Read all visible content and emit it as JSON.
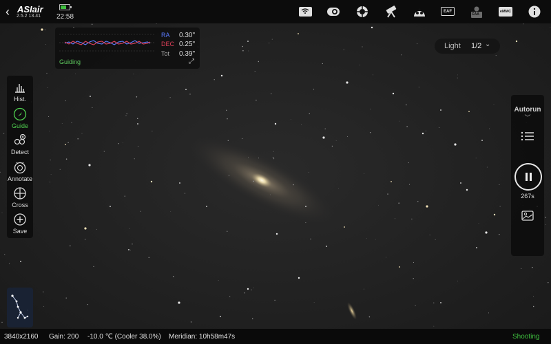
{
  "app": {
    "brand": "ASIair",
    "version": "2.5.2 13.41",
    "clock": "22:58",
    "battery_level": 0.7
  },
  "toolbar_icons": [
    {
      "name": "wifi-icon",
      "label": ""
    },
    {
      "name": "camera-icon",
      "label": ""
    },
    {
      "name": "guide-scope-icon",
      "label": ""
    },
    {
      "name": "telescope-mount-icon",
      "label": ""
    },
    {
      "name": "filter-wheel-icon",
      "label": ""
    },
    {
      "name": "eaf-focuser-icon",
      "label": "EAF"
    },
    {
      "name": "caa-rotator-icon",
      "label": "CAA"
    },
    {
      "name": "emmc-storage-icon",
      "label": "eMMC"
    },
    {
      "name": "info-icon",
      "label": ""
    }
  ],
  "guide": {
    "ra_label": "RA",
    "ra_value": "0.30\"",
    "dec_label": "DEC",
    "dec_value": "0.25\"",
    "tot_label": "Tot",
    "tot_value": "0.39\"",
    "status": "Guiding",
    "ra_color": "#5a7bff",
    "dec_color": "#e0405a"
  },
  "frame_selector": {
    "type": "Light",
    "index": "1/2"
  },
  "left_tools": [
    {
      "label": "Hist.",
      "icon": "histogram-icon"
    },
    {
      "label": "Guide",
      "icon": "guide-icon",
      "active": true
    },
    {
      "label": "Detect",
      "icon": "detect-stars-icon"
    },
    {
      "label": "Annotate",
      "icon": "annotate-icon"
    },
    {
      "label": "Cross",
      "icon": "crosshair-icon"
    },
    {
      "label": "Save",
      "icon": "save-plus-icon"
    }
  ],
  "right_panel": {
    "mode": "Autorun",
    "exposure_remaining": "267s"
  },
  "status": {
    "resolution": "3840x2160",
    "gain": "Gain: 200",
    "temperature": "-10.0 ℃ (Cooler 38.0%)",
    "meridian": "Meridian: 10h58m47s",
    "state": "Shooting"
  },
  "colors": {
    "accent_green": "#3fbf3f",
    "panel_bg": "#0c0c0c"
  }
}
